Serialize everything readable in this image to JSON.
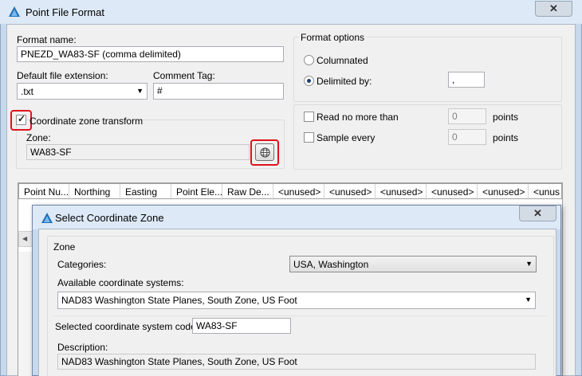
{
  "main_window": {
    "title": "Point File Format",
    "close_glyph": "✕",
    "format_name_label": "Format name:",
    "format_name_value": "PNEZD_WA83-SF (comma delimited)",
    "default_ext_label": "Default file extension:",
    "default_ext_value": ".txt",
    "comment_tag_label": "Comment Tag:",
    "comment_tag_value": "#",
    "coord_transform_label": "Coordinate zone transform",
    "zone_label": "Zone:",
    "zone_value": "WA83-SF",
    "format_options": {
      "legend": "Format options",
      "columnated_label": "Columnated",
      "delimited_label": "Delimited by:",
      "delimiter_value": ",",
      "read_no_more_label": "Read no more than",
      "read_no_more_value": "0",
      "read_no_more_unit": "points",
      "sample_every_label": "Sample every",
      "sample_every_value": "0",
      "sample_every_unit": "points"
    },
    "columns": [
      "Point Nu...",
      "Northing",
      "Easting",
      "Point Ele...",
      "Raw De...",
      "<unused>",
      "<unused>",
      "<unused>",
      "<unused>",
      "<unused>",
      "<unus"
    ]
  },
  "dialog": {
    "title": "Select Coordinate Zone",
    "close_glyph": "✕",
    "group_label": "Zone",
    "categories_label": "Categories:",
    "categories_value": "USA, Washington",
    "available_label": "Available coordinate systems:",
    "available_value": "NAD83 Washington State Planes, South Zone, US Foot",
    "selected_code_label": "Selected coordinate system code:",
    "selected_code_value": "WA83-SF",
    "description_label": "Description:",
    "description_value": "NAD83 Washington State Planes, South Zone, US Foot"
  },
  "icons": {
    "app": "autodesk-civil-icon",
    "globe": "globe-icon",
    "dropdown": "chevron-down-icon"
  },
  "colors": {
    "highlight": "#e0121b",
    "titlebar": "#dde9f6",
    "window_frame": "#c9d9ec"
  }
}
